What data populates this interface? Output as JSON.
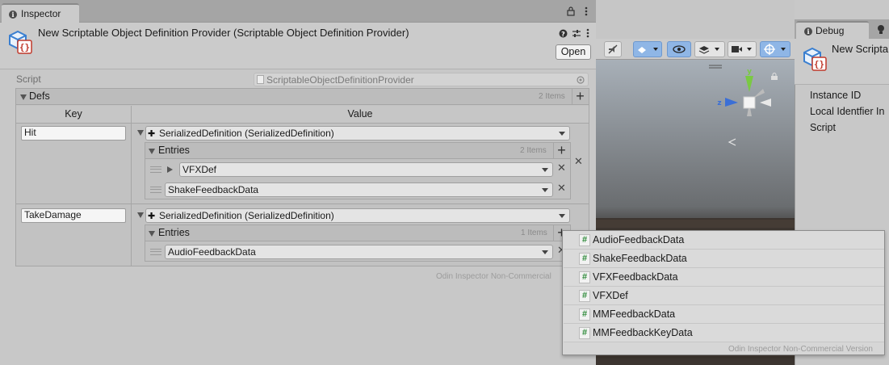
{
  "inspector": {
    "tab_label": "Inspector",
    "title": "New Scriptable Object Definition Provider (Scriptable Object Definition Provider)",
    "open_label": "Open",
    "script_label": "Script",
    "script_value": "ScriptableObjectDefinitionProvider",
    "defs": {
      "label": "Defs",
      "count": "2 Items",
      "key_header": "Key",
      "value_header": "Value",
      "rows": [
        {
          "key": "Hit",
          "type": "SerializedDefinition (SerializedDefinition)",
          "entries_label": "Entries",
          "entries_count": "2 Items",
          "entries": [
            "VFXDef",
            "ShakeFeedbackData"
          ]
        },
        {
          "key": "TakeDamage",
          "type": "SerializedDefinition (SerializedDefinition)",
          "entries_label": "Entries",
          "entries_count": "1 Items",
          "entries": [
            "AudioFeedbackData"
          ]
        }
      ]
    },
    "watermark": "Odin Inspector Non-Commercial"
  },
  "debug": {
    "tab_label": "Debug",
    "title": "New Scripta",
    "rows": [
      "Instance ID",
      "Local Identfier In",
      "Script"
    ]
  },
  "scene": {
    "axis_z": "z"
  },
  "popup": {
    "items": [
      "AudioFeedbackData",
      "ShakeFeedbackData",
      "VFXFeedbackData",
      "VFXDef",
      "MMFeedbackData",
      "MMFeedbackKeyData"
    ],
    "watermark": "Odin Inspector Non-Commercial Version"
  },
  "colors": {
    "accent_blue": "#4a8ad8",
    "hash_green": "#2e8b3a",
    "icon_red": "#c0392b"
  }
}
